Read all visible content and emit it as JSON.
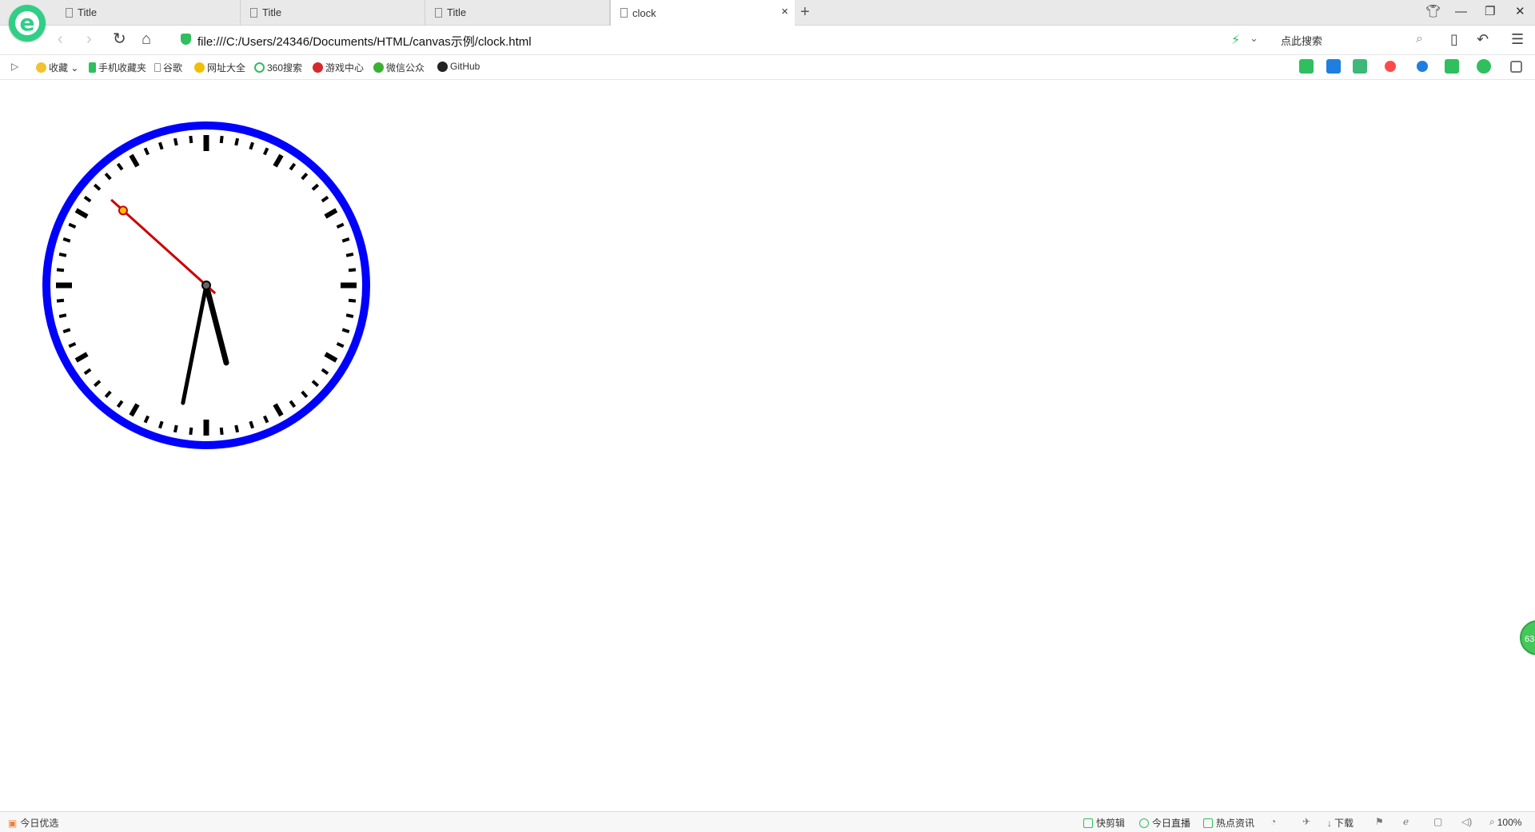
{
  "tabs": [
    {
      "title": "Title"
    },
    {
      "title": "Title"
    },
    {
      "title": "Title"
    },
    {
      "title": "clock",
      "active": true
    }
  ],
  "address": {
    "url": "file:///C:/Users/24346/Documents/HTML/canvas示例/clock.html"
  },
  "search": {
    "placeholder": "点此搜索"
  },
  "bookmarks": [
    {
      "label": "收藏",
      "icon": "star-icon"
    },
    {
      "label": "手机收藏夹",
      "icon": "phone-icon"
    },
    {
      "label": "谷歌",
      "icon": "page-icon"
    },
    {
      "label": "网址大全",
      "icon": "globe-icon"
    },
    {
      "label": "360搜索",
      "icon": "360-icon"
    },
    {
      "label": "游戏中心",
      "icon": "game-icon"
    },
    {
      "label": "微信公众",
      "icon": "wechat-icon"
    },
    {
      "label": "GitHub",
      "icon": "github-icon"
    }
  ],
  "clock": {
    "hour": 5,
    "minute": 31,
    "second": 52,
    "rim_color": "#0000ff",
    "hand_color": "#000000",
    "second_hand_color": "#cc0000"
  },
  "floating_badge": {
    "text": "63"
  },
  "statusbar": {
    "today_pick": "今日优选",
    "quick_clip": "快剪辑",
    "today_live": "今日直播",
    "hot_news": "热点资讯",
    "download": "下载",
    "zoom": "100%"
  },
  "colors": {
    "accent": "#2fcf86",
    "secure": "#2fbf5e"
  }
}
